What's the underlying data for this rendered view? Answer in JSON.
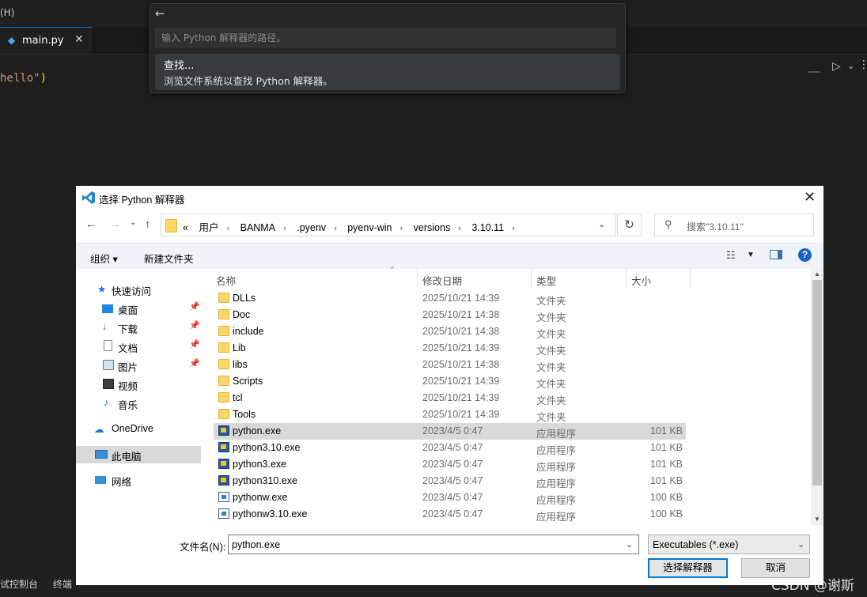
{
  "vscode": {
    "menu_fragment": "(H)",
    "tab": {
      "label": "main.py",
      "close": "✕"
    },
    "code_line": {
      "text": "hello\"",
      "paren": ")"
    },
    "status": {
      "left1": "试控制台",
      "left2": "终端"
    }
  },
  "quickpick": {
    "back": "←",
    "placeholder": "输入 Python 解释器的路径。",
    "item_title": "查找...",
    "item_desc": "浏览文件系统以查找 Python 解释器。"
  },
  "dialog": {
    "title": "选择 Python 解释器",
    "close": "✕",
    "breadcrumbs": [
      "«",
      "用户",
      "BANMA",
      ".pyenv",
      "pyenv-win",
      "versions",
      "3.10.11"
    ],
    "search_placeholder": "搜索\"3.10.11\"",
    "toolbar": {
      "organize": "组织 ▾",
      "new_folder": "新建文件夹"
    },
    "tree": {
      "quick_access": "快速访问",
      "desktop": "桌面",
      "downloads": "下载",
      "documents": "文档",
      "pictures": "图片",
      "videos": "视频",
      "music": "音乐",
      "onedrive": "OneDrive",
      "this_pc": "此电脑",
      "network": "网络"
    },
    "columns": {
      "name": "名称",
      "modified": "修改日期",
      "type": "类型",
      "size": "大小"
    },
    "files": [
      {
        "name": "DLLs",
        "date": "2025/10/21 14:39",
        "type": "文件夹",
        "size": "",
        "icon": "folder-icon"
      },
      {
        "name": "Doc",
        "date": "2025/10/21 14:38",
        "type": "文件夹",
        "size": "",
        "icon": "folder-icon"
      },
      {
        "name": "include",
        "date": "2025/10/21 14:38",
        "type": "文件夹",
        "size": "",
        "icon": "folder-icon"
      },
      {
        "name": "Lib",
        "date": "2025/10/21 14:39",
        "type": "文件夹",
        "size": "",
        "icon": "folder-icon"
      },
      {
        "name": "libs",
        "date": "2025/10/21 14:38",
        "type": "文件夹",
        "size": "",
        "icon": "folder-icon"
      },
      {
        "name": "Scripts",
        "date": "2025/10/21 14:39",
        "type": "文件夹",
        "size": "",
        "icon": "folder-icon"
      },
      {
        "name": "tcl",
        "date": "2025/10/21 14:39",
        "type": "文件夹",
        "size": "",
        "icon": "folder-icon"
      },
      {
        "name": "Tools",
        "date": "2025/10/21 14:39",
        "type": "文件夹",
        "size": "",
        "icon": "folder-icon"
      },
      {
        "name": "python.exe",
        "date": "2023/4/5 0:47",
        "type": "应用程序",
        "size": "101 KB",
        "icon": "python-exe-icon",
        "selected": true
      },
      {
        "name": "python3.10.exe",
        "date": "2023/4/5 0:47",
        "type": "应用程序",
        "size": "101 KB",
        "icon": "python-exe-icon"
      },
      {
        "name": "python3.exe",
        "date": "2023/4/5 0:47",
        "type": "应用程序",
        "size": "101 KB",
        "icon": "python-exe-icon"
      },
      {
        "name": "python310.exe",
        "date": "2023/4/5 0:47",
        "type": "应用程序",
        "size": "101 KB",
        "icon": "python-exe-icon"
      },
      {
        "name": "pythonw.exe",
        "date": "2023/4/5 0:47",
        "type": "应用程序",
        "size": "100 KB",
        "icon": "pythonw-exe-icon"
      },
      {
        "name": "pythonw3.10.exe",
        "date": "2023/4/5 0:47",
        "type": "应用程序",
        "size": "100 KB",
        "icon": "pythonw-exe-icon"
      }
    ],
    "filename_label": "文件名(N):",
    "filename_value": "python.exe",
    "filetype": "Executables (*.exe)",
    "ok": "选择解释器",
    "cancel": "取消"
  },
  "watermark": "CSDN @谢斯"
}
